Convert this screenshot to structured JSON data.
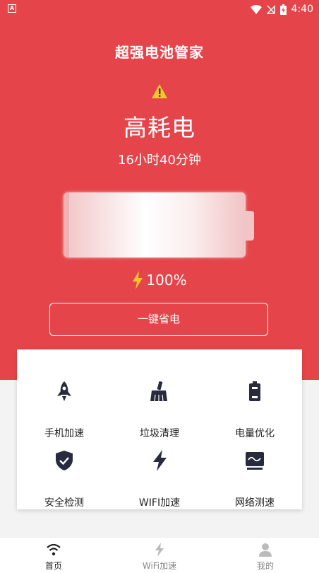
{
  "status_bar": {
    "time": "4:40",
    "left_icon": "notification-icon",
    "icons": [
      "wifi-icon",
      "no-signal-icon",
      "battery-charging-icon"
    ]
  },
  "header": {
    "title": "超强电池管家"
  },
  "battery": {
    "status_icon": "warning-icon",
    "status": "高耗电",
    "remaining_time": "16小时40分钟",
    "level_text": "100%",
    "level_fraction": 1.0,
    "charging_icon": "lightning-icon"
  },
  "action": {
    "save_button": "一键省电"
  },
  "tools": [
    {
      "label": "手机加速",
      "icon": "rocket-icon"
    },
    {
      "label": "垃圾清理",
      "icon": "broom-icon"
    },
    {
      "label": "电量优化",
      "icon": "battery-icon"
    },
    {
      "label": "安全检测",
      "icon": "shield-check-icon"
    },
    {
      "label": "WIFI加速",
      "icon": "lightning-icon"
    },
    {
      "label": "网络测速",
      "icon": "monitor-wave-icon"
    }
  ],
  "bottom_nav": [
    {
      "label": "首页",
      "icon": "wifi-icon",
      "active": true
    },
    {
      "label": "WiFi加速",
      "icon": "lightning-icon",
      "active": false
    },
    {
      "label": "我的",
      "icon": "user-icon",
      "active": false
    }
  ],
  "colors": {
    "primary": "#e5454a",
    "icon_dark": "#272b3d",
    "nav_active": "#222222",
    "nav_inactive": "#aaaaaa"
  }
}
